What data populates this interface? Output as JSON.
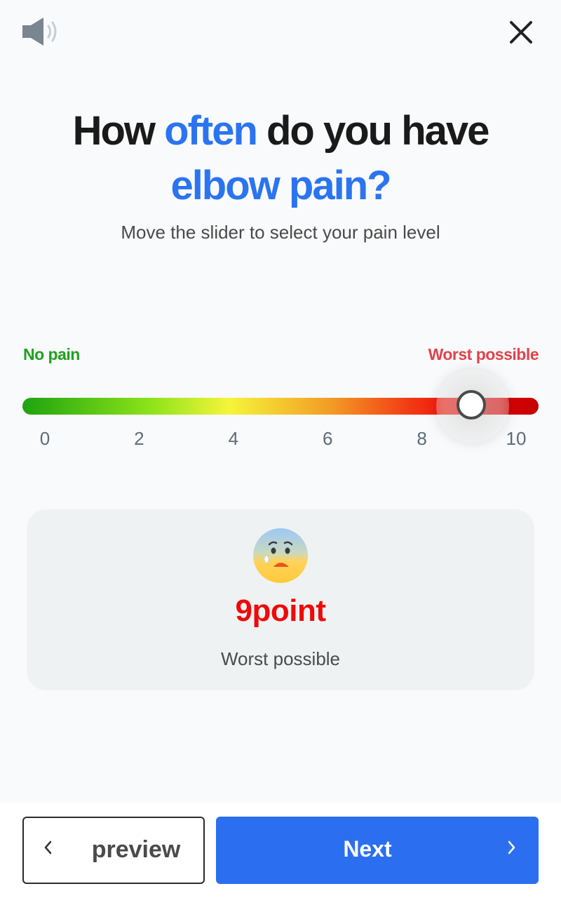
{
  "header": {
    "speaker_icon": "speaker-volume-icon",
    "close_icon": "close-icon"
  },
  "question": {
    "title_part1": "How ",
    "title_accent1": "often",
    "title_part2": " do you have",
    "title_accent2": "elbow pain?",
    "subtitle": "Move the slider to select your pain level"
  },
  "slider": {
    "min_label": "No pain",
    "max_label": "Worst possible",
    "min": 0,
    "max": 10,
    "value": 9,
    "ticks": [
      "0",
      "2",
      "4",
      "6",
      "8",
      "10"
    ]
  },
  "result": {
    "emoji_icon": "anxious-face-with-sweat-icon",
    "score": "9point",
    "description": "Worst possible"
  },
  "footer": {
    "prev_label": "preview",
    "next_label": "Next",
    "prev_icon": "chevron-left-icon",
    "next_icon": "chevron-right-icon"
  },
  "colors": {
    "accent": "#2b74f0",
    "no_pain": "#1fa11f",
    "worst": "#e0434b",
    "score": "#ee0a0a",
    "next_button": "#2b6ff0"
  }
}
